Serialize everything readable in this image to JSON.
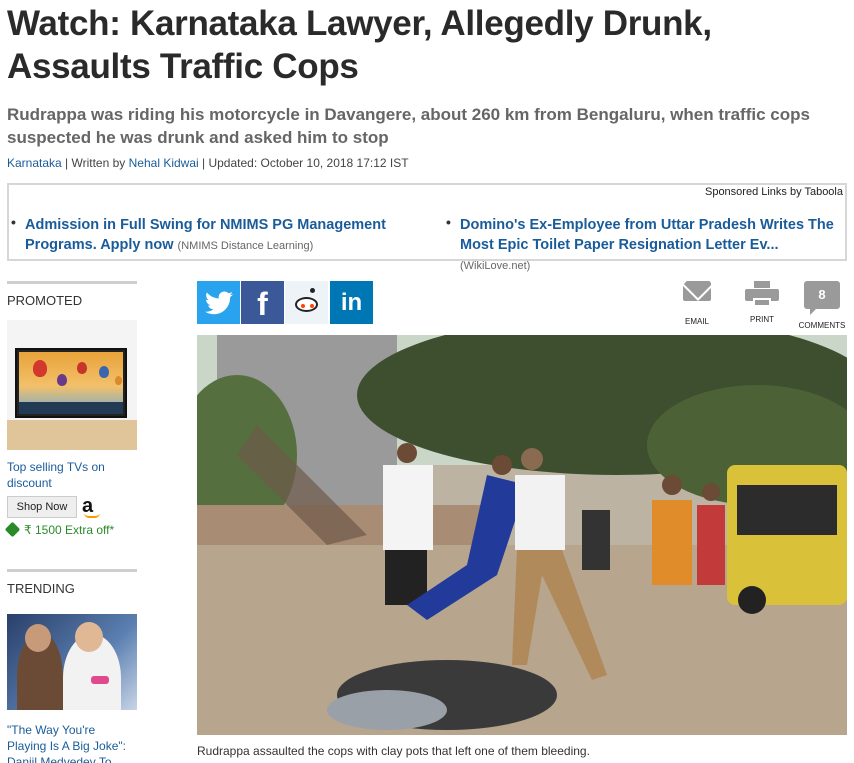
{
  "article": {
    "headline": "Watch: Karnataka Lawyer, Allegedly Drunk, Assaults Traffic Cops",
    "subhead": "Rudrappa was riding his motorcycle in Davangere, about 260 km from Bengaluru, when traffic cops suspected he was drunk and asked him to stop",
    "byline": {
      "section": "Karnataka",
      "written_by_prefix": " | Written by ",
      "author": "Nehal Kidwai",
      "updated": " | Updated: October 10, 2018 17:12 IST"
    },
    "photo_caption": "Rudrappa assaulted the cops with clay pots that left one of them bleeding."
  },
  "sponsored": {
    "label": "Sponsored Links by Taboola",
    "items": [
      {
        "title": "Admission in Full Swing for NMIMS PG Management Programs. Apply now",
        "source": "(NMIMS Distance Learning)"
      },
      {
        "title": "Domino's Ex-Employee from Uttar Pradesh Writes The Most Epic Toilet Paper Resignation Letter Ev...",
        "source": "(WikiLove.net)"
      }
    ]
  },
  "sidebar": {
    "promoted_label": "PROMOTED",
    "promo_text": "Top selling TVs on discount",
    "shop_button": "Shop Now",
    "amazon_logo_letter": "a",
    "offer": "₹ 1500 Extra off*",
    "trending_label": "TRENDING",
    "trending_text": "\"The Way You're Playing Is A Big Joke\": Daniil Medvedev To Rafael"
  },
  "share": {
    "twitter_glyph": "🐦",
    "facebook_glyph": "f",
    "linkedin_glyph": "in"
  },
  "utilities": {
    "email_label": "EMAIL",
    "print_label": "PRINT",
    "comments_label": "COMMENTS",
    "comments_count": "8"
  },
  "colors": {
    "link_blue": "#1a5c9a",
    "twitter": "#2aa3ef",
    "facebook": "#3b5998",
    "linkedin": "#0077b5",
    "offer_green": "#2a8a2a"
  }
}
